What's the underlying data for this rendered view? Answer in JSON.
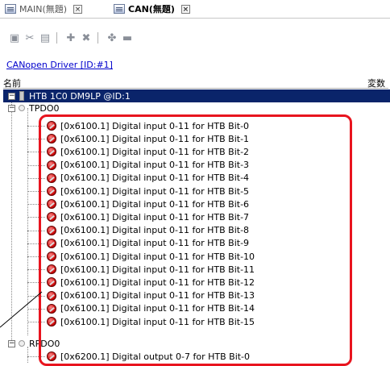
{
  "tabs": [
    {
      "label": "MAIN(無題)",
      "icon": "list-window-icon",
      "close": "×"
    },
    {
      "label": "CAN(無題)",
      "icon": "list-window-icon",
      "close": "×"
    }
  ],
  "toolbar": {
    "icons": [
      "add-node-icon",
      "cut-icon",
      "paste-icon",
      "delete-node-icon",
      "close-icon",
      "settings-icon",
      "monitor-icon"
    ]
  },
  "link": "CANopen Driver [ID:#1]",
  "columns": {
    "name": "名前",
    "variable": "変数"
  },
  "device_node": "HTB 1C0 DM9LP @ID:1",
  "groups": {
    "tpdo": "TPDO0",
    "rpdo": "RPDO0"
  },
  "tpdo_items": [
    "[0x6100.1] Digital input 0-11 for HTB Bit-0",
    "[0x6100.1] Digital input 0-11 for HTB Bit-1",
    "[0x6100.1] Digital input 0-11 for HTB Bit-2",
    "[0x6100.1] Digital input 0-11 for HTB Bit-3",
    "[0x6100.1] Digital input 0-11 for HTB Bit-4",
    "[0x6100.1] Digital input 0-11 for HTB Bit-5",
    "[0x6100.1] Digital input 0-11 for HTB Bit-6",
    "[0x6100.1] Digital input 0-11 for HTB Bit-7",
    "[0x6100.1] Digital input 0-11 for HTB Bit-8",
    "[0x6100.1] Digital input 0-11 for HTB Bit-9",
    "[0x6100.1] Digital input 0-11 for HTB Bit-10",
    "[0x6100.1] Digital input 0-11 for HTB Bit-11",
    "[0x6100.1] Digital input 0-11 for HTB Bit-12",
    "[0x6100.1] Digital input 0-11 for HTB Bit-13",
    "[0x6100.1] Digital input 0-11 for HTB Bit-14",
    "[0x6100.1] Digital input 0-11 for HTB Bit-15"
  ],
  "rpdo_items": [
    "[0x6200.1] Digital output 0-7 for HTB Bit-0"
  ],
  "colors": {
    "selection": "#0a246a",
    "highlight": "#e8141e",
    "link": "#0000cc"
  }
}
